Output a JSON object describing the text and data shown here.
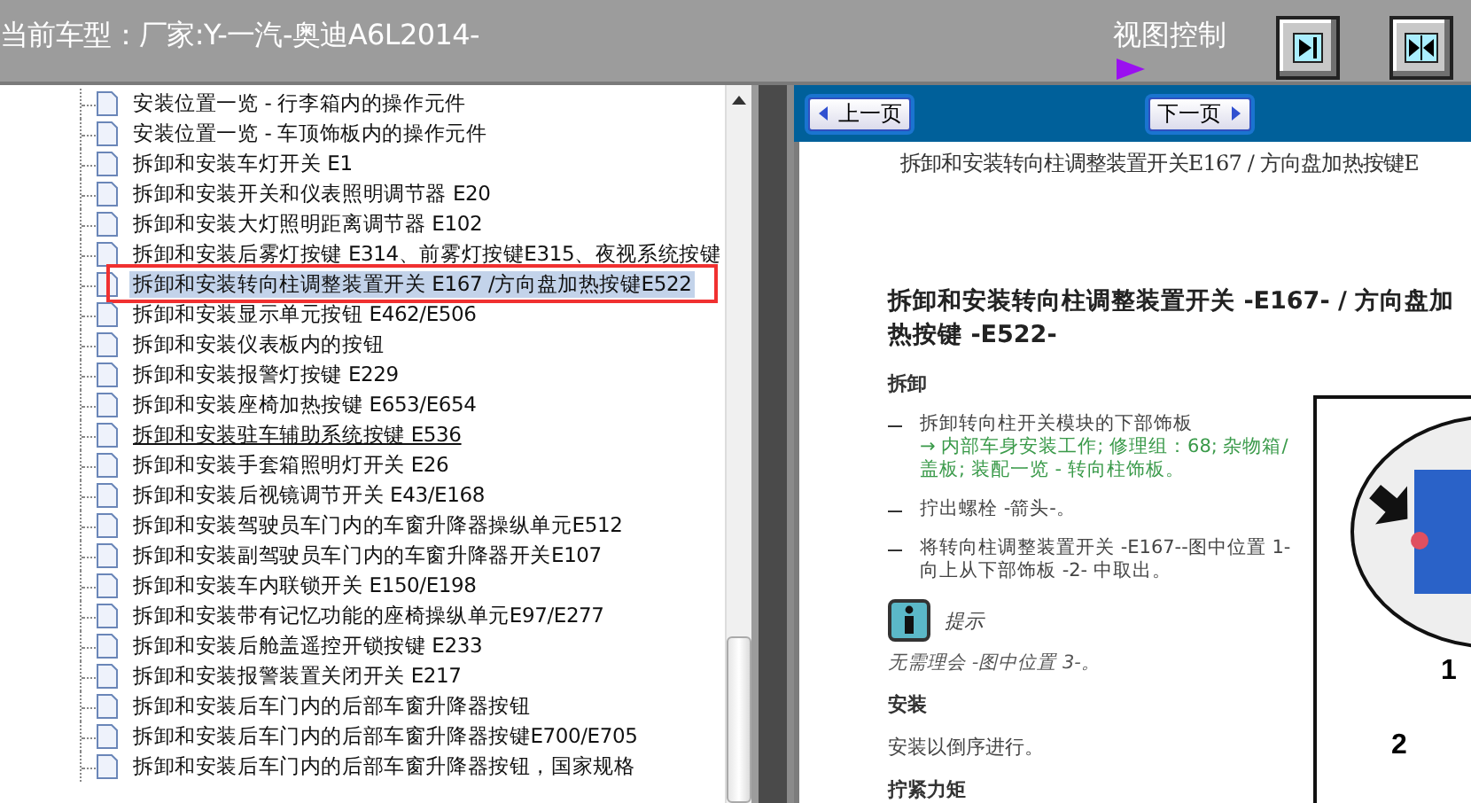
{
  "header": {
    "title": "当前车型：厂家:Y-一汽-奥迪A6L2014-",
    "view_control_label": "视图控制"
  },
  "tree": {
    "rows": [
      {
        "text": "安装位置一览 - 行李箱内的操作元件",
        "selected": false,
        "underlined": false,
        "outlined": false
      },
      {
        "text": "安装位置一览 - 车顶饰板内的操作元件",
        "selected": false,
        "underlined": false,
        "outlined": false
      },
      {
        "text": "拆卸和安装车灯开关  E1",
        "selected": false,
        "underlined": false,
        "outlined": false
      },
      {
        "text": "拆卸和安装开关和仪表照明调节器  E20",
        "selected": false,
        "underlined": false,
        "outlined": false
      },
      {
        "text": "拆卸和安装大灯照明距离调节器  E102",
        "selected": false,
        "underlined": false,
        "outlined": false
      },
      {
        "text": "拆卸和安装后雾灯按键  E314、前雾灯按键E315、夜视系统按键",
        "selected": false,
        "underlined": false,
        "outlined": false
      },
      {
        "text": "拆卸和安装转向柱调整装置开关  E167 /方向盘加热按键E522",
        "selected": true,
        "underlined": false,
        "outlined": true
      },
      {
        "text": "拆卸和安装显示单元按钮  E462/E506",
        "selected": false,
        "underlined": false,
        "outlined": false
      },
      {
        "text": "拆卸和安装仪表板内的按钮",
        "selected": false,
        "underlined": false,
        "outlined": false
      },
      {
        "text": "拆卸和安装报警灯按键  E229",
        "selected": false,
        "underlined": false,
        "outlined": false
      },
      {
        "text": "拆卸和安装座椅加热按键  E653/E654",
        "selected": false,
        "underlined": false,
        "outlined": false
      },
      {
        "text": "拆卸和安装驻车辅助系统按键  E536",
        "selected": false,
        "underlined": true,
        "outlined": false
      },
      {
        "text": "拆卸和安装手套箱照明灯开关  E26",
        "selected": false,
        "underlined": false,
        "outlined": false
      },
      {
        "text": "拆卸和安装后视镜调节开关  E43/E168",
        "selected": false,
        "underlined": false,
        "outlined": false
      },
      {
        "text": "拆卸和安装驾驶员车门内的车窗升降器操纵单元E512",
        "selected": false,
        "underlined": false,
        "outlined": false
      },
      {
        "text": "拆卸和安装副驾驶员车门内的车窗升降器开关E107",
        "selected": false,
        "underlined": false,
        "outlined": false
      },
      {
        "text": "拆卸和安装车内联锁开关  E150/E198",
        "selected": false,
        "underlined": false,
        "outlined": false
      },
      {
        "text": "拆卸和安装带有记忆功能的座椅操纵单元E97/E277",
        "selected": false,
        "underlined": false,
        "outlined": false
      },
      {
        "text": "拆卸和安装后舱盖遥控开锁按键  E233",
        "selected": false,
        "underlined": false,
        "outlined": false
      },
      {
        "text": "拆卸和安装报警装置关闭开关  E217",
        "selected": false,
        "underlined": false,
        "outlined": false
      },
      {
        "text": "拆卸和安装后车门内的后部车窗升降器按钮",
        "selected": false,
        "underlined": false,
        "outlined": false
      },
      {
        "text": "拆卸和安装后车门内的后部车窗升降器按键E700/E705",
        "selected": false,
        "underlined": false,
        "outlined": false
      },
      {
        "text": "拆卸和安装后车门内的后部车窗升降器按钮，国家规格",
        "selected": false,
        "underlined": false,
        "outlined": false
      }
    ]
  },
  "navigation": {
    "previous": "上一页",
    "next": "下一页"
  },
  "document": {
    "running_header": "拆卸和安装转向柱调整装置开关E167 / 方向盘加热按键E",
    "title": "拆卸和安装转向柱调整装置开关 -E167- / 方向盘加热按键 -E522-",
    "blocks": [
      {
        "kind": "section",
        "text": "拆卸"
      },
      {
        "kind": "step",
        "text": "拆卸转向柱开关模块的下部饰板 ",
        "link": "→ 内部车身安装工作; 修理组：68; 杂物箱/盖板; 装配一览 - 转向柱饰板。"
      },
      {
        "kind": "step",
        "text": "拧出螺栓 -箭头-。"
      },
      {
        "kind": "step",
        "text": "将转向柱调整装置开关 -E167--图中位置 1- 向上从下部饰板 -2- 中取出。"
      },
      {
        "kind": "note",
        "label": "提示",
        "text": "无需理会 -图中位置 3-。"
      },
      {
        "kind": "section",
        "text": "安装"
      },
      {
        "kind": "paragraph",
        "text": "安装以倒序进行。"
      },
      {
        "kind": "section",
        "text": "拧紧力矩"
      }
    ],
    "figure_labels": [
      "1",
      "2"
    ]
  }
}
